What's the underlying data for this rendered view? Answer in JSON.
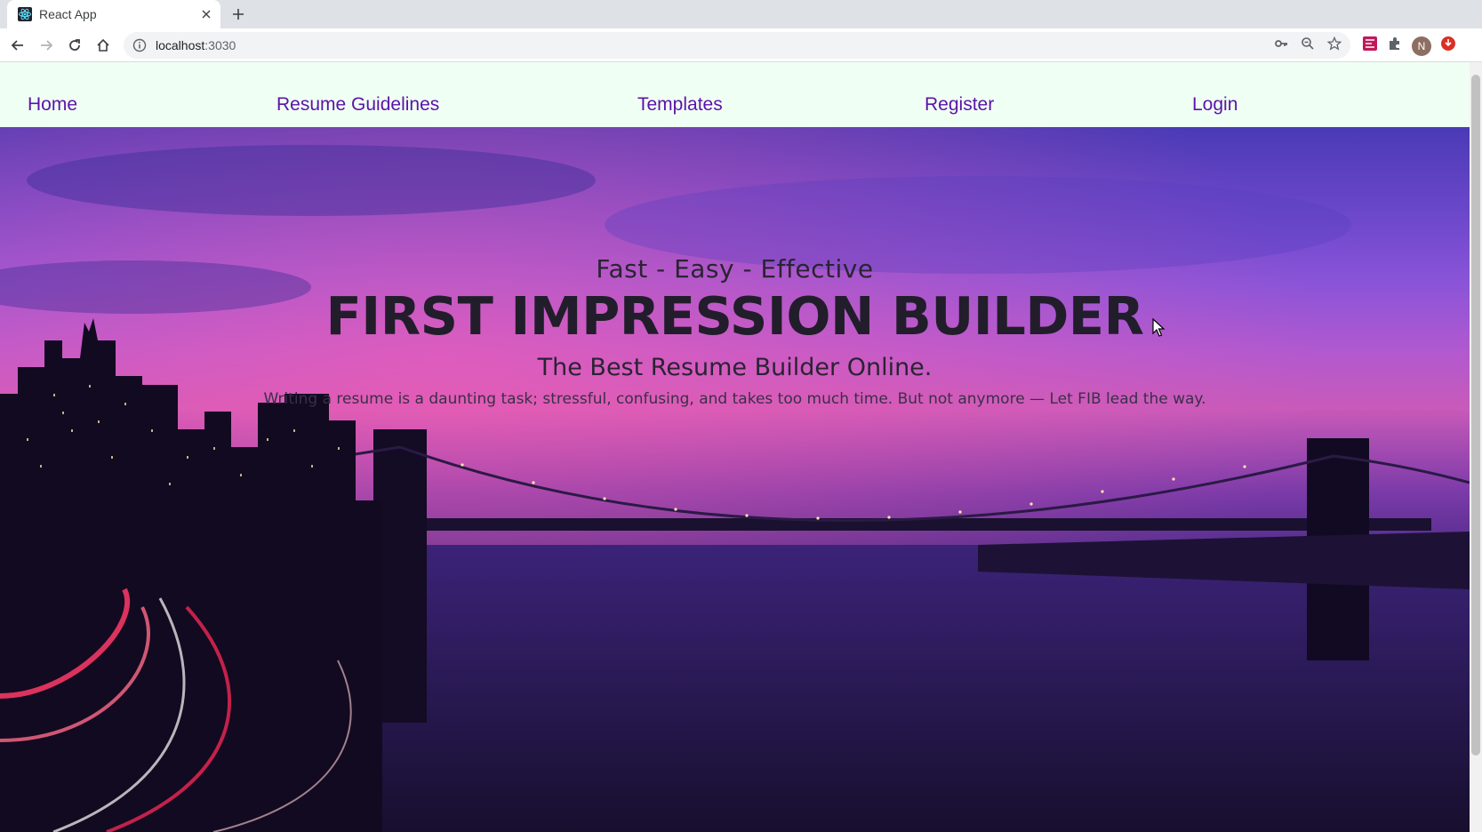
{
  "browser": {
    "tab": {
      "title": "React App",
      "favicon": "react-icon"
    },
    "url": {
      "host": "localhost",
      "port": ":3030"
    },
    "profile_initial": "N"
  },
  "navbar": {
    "links": [
      {
        "label": "Home"
      },
      {
        "label": "Resume Guidelines"
      },
      {
        "label": "Templates"
      },
      {
        "label": "Register"
      },
      {
        "label": "Login"
      }
    ],
    "background": "#f0fff4",
    "link_color": "#5b13a8"
  },
  "hero": {
    "tagline": "Fast - Easy - Effective",
    "title": "FIRST IMPRESSION BUILDER",
    "subtitle": "The Best Resume Builder Online.",
    "description": "Writing a resume is a daunting task; stressful, confusing, and takes too much time. But not anymore — Let FIB lead the way.",
    "background_image": "city-bridge-night-sky"
  }
}
